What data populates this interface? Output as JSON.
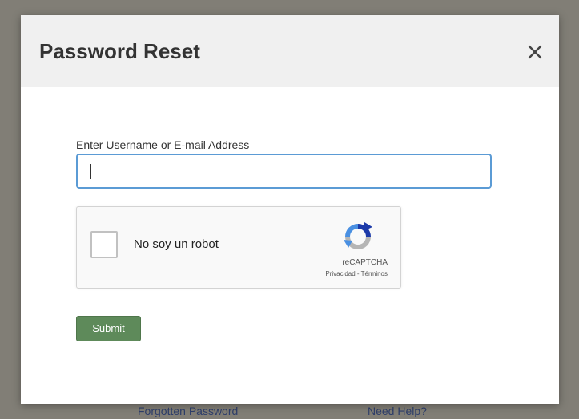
{
  "modal": {
    "title": "Password Reset",
    "close_label": "×"
  },
  "form": {
    "username_label": "Enter Username or E-mail Address",
    "username_value": "",
    "submit_label": "Submit"
  },
  "recaptcha": {
    "label": "No soy un robot",
    "brand": "reCAPTCHA",
    "links": "Privacidad - Términos",
    "logo_icon": "recaptcha-logo-icon",
    "colors": {
      "blue": "#4a90e2",
      "dark_blue": "#1c3aa9",
      "gray": "#b5b5b5"
    }
  },
  "footer": {
    "forgot_password": "Forgotten Password",
    "need_help": "Need Help?"
  },
  "colors": {
    "backdrop": "#817e76",
    "header_bg": "#f0f0f0",
    "input_border": "#5b9bd5",
    "submit_bg": "#5e8a5a",
    "footer_link": "#2e3e6a"
  }
}
